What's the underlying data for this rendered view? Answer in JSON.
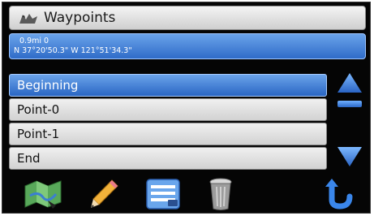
{
  "header": {
    "title": "Waypoints",
    "icon": "waypoints-flag-icon"
  },
  "info": {
    "distance": "0.9mi  0",
    "coordinates": "N 37°20'50.3\"  W 121°51'34.3\""
  },
  "list": {
    "items": [
      {
        "label": "Beginning",
        "selected": true
      },
      {
        "label": "Point-0",
        "selected": false
      },
      {
        "label": "Point-1",
        "selected": false
      },
      {
        "label": "End",
        "selected": false
      }
    ]
  },
  "toolbar": {
    "buttons": [
      "map-icon",
      "pencil-icon",
      "list-icon",
      "trash-icon",
      "back-arrow-icon"
    ]
  },
  "colors": {
    "accent": "#2f6cc8",
    "background": "#050505"
  }
}
